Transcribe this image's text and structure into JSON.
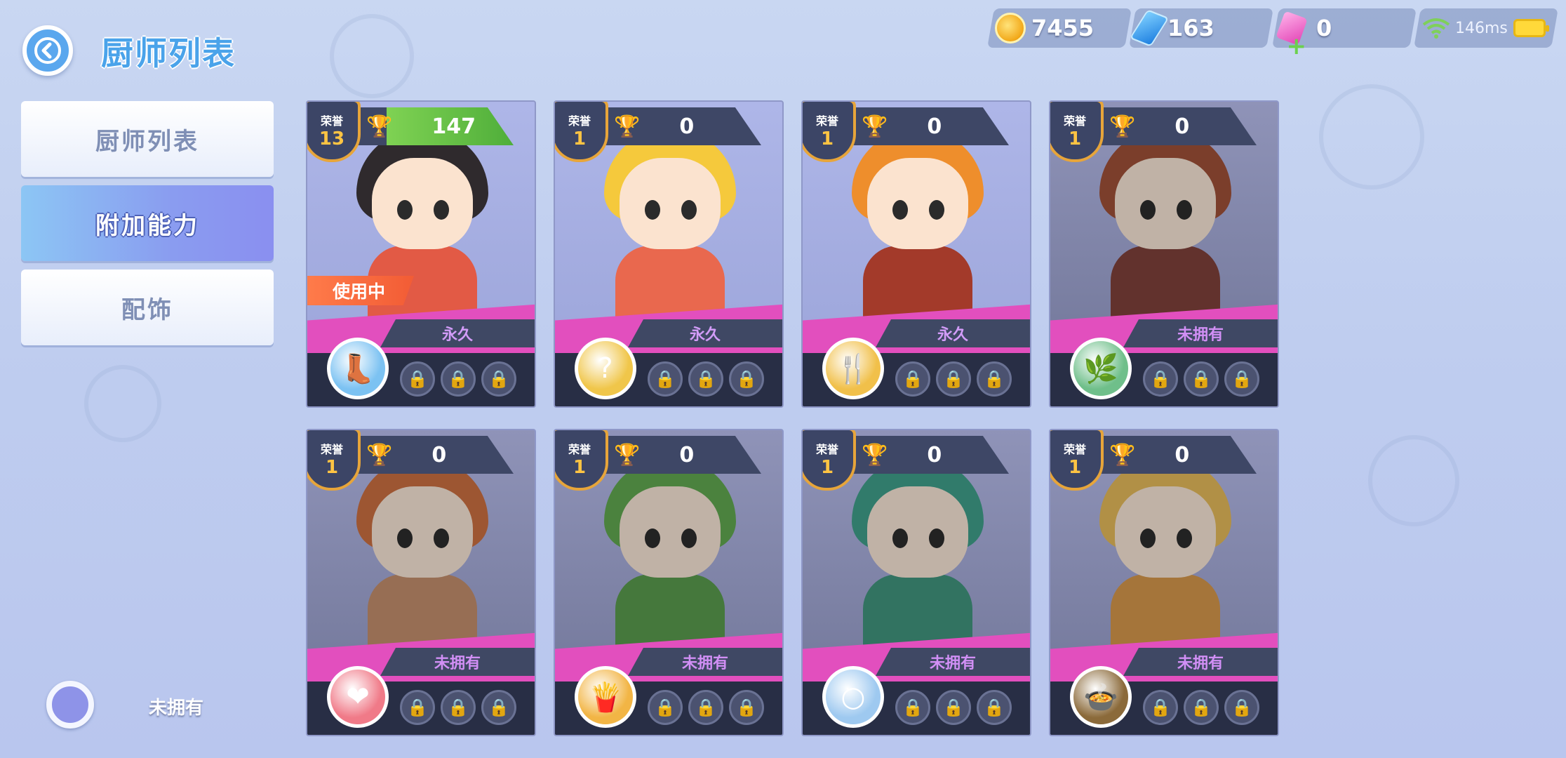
{
  "header": {
    "title": "厨师列表",
    "back_icon": "back-arrow-icon"
  },
  "resources": {
    "coins": "7455",
    "gems": "163",
    "special": "0",
    "ping": "146ms"
  },
  "menu": [
    {
      "label": "厨师列表",
      "active": false
    },
    {
      "label": "附加能力",
      "active": true
    },
    {
      "label": "配饰",
      "active": false
    }
  ],
  "filter": {
    "label": "未拥有"
  },
  "honor_label": "荣誉",
  "in_use_label": "使用中",
  "cards": [
    {
      "honor": "13",
      "trophies": "147",
      "ownership": "永久",
      "in_use": true,
      "skill_icon": "boot-icon",
      "owned": true
    },
    {
      "honor": "1",
      "trophies": "0",
      "ownership": "永久",
      "in_use": false,
      "skill_icon": "mystery-box-icon",
      "owned": true
    },
    {
      "honor": "1",
      "trophies": "0",
      "ownership": "永久",
      "in_use": false,
      "skill_icon": "gold-utensils-icon",
      "owned": true
    },
    {
      "honor": "1",
      "trophies": "0",
      "ownership": "未拥有",
      "in_use": false,
      "skill_icon": "herb-icon",
      "owned": false
    },
    {
      "honor": "1",
      "trophies": "0",
      "ownership": "未拥有",
      "in_use": false,
      "skill_icon": "heart-icon",
      "owned": false
    },
    {
      "honor": "1",
      "trophies": "0",
      "ownership": "未拥有",
      "in_use": false,
      "skill_icon": "chips-icon",
      "owned": false
    },
    {
      "honor": "1",
      "trophies": "0",
      "ownership": "未拥有",
      "in_use": false,
      "skill_icon": "bubbles-icon",
      "owned": false
    },
    {
      "honor": "1",
      "trophies": "0",
      "ownership": "未拥有",
      "in_use": false,
      "skill_icon": "cooking-pot-icon",
      "owned": false
    }
  ]
}
